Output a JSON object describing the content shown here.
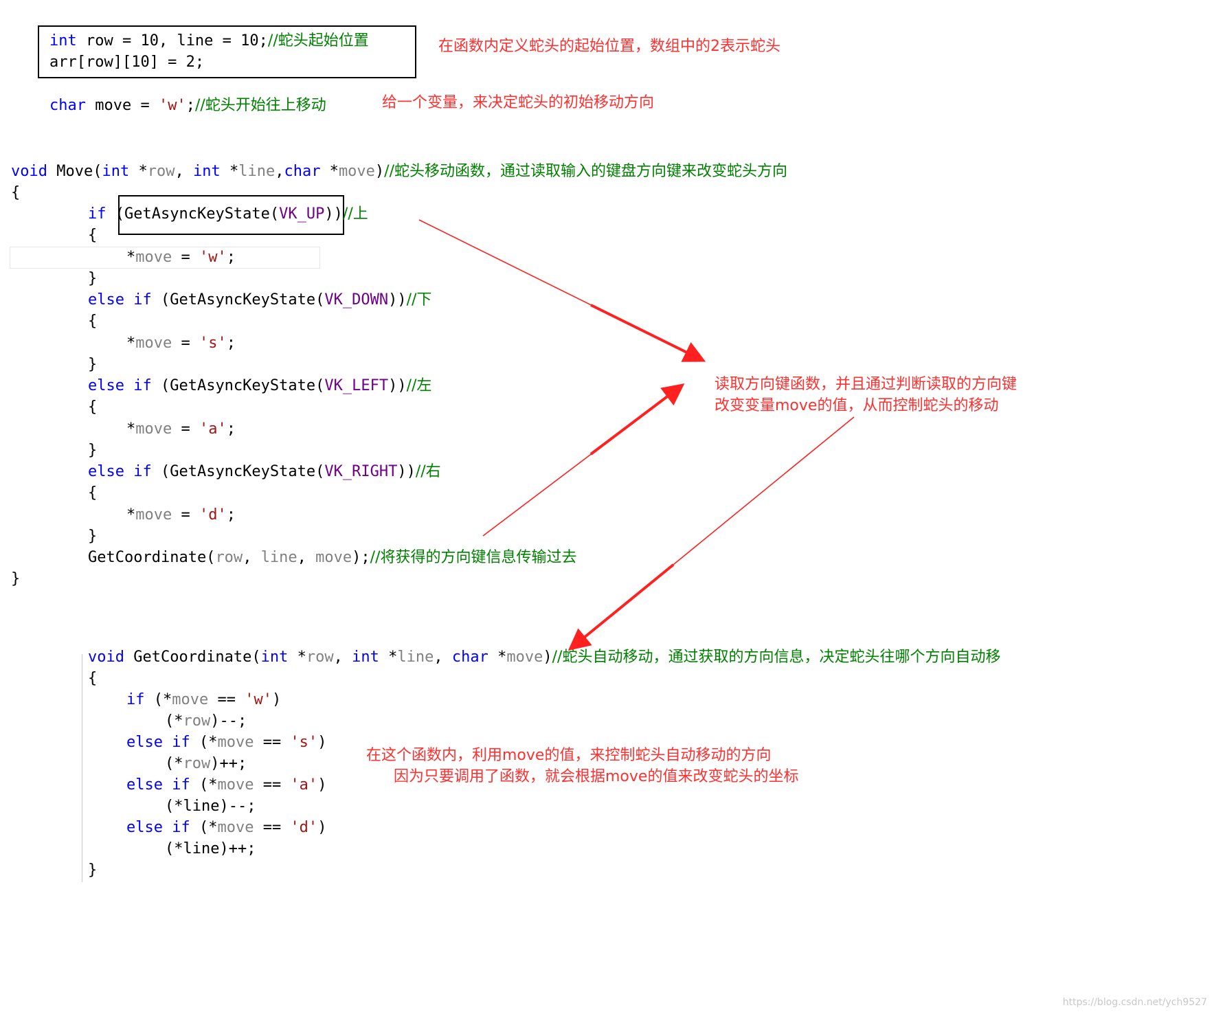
{
  "code_top": {
    "line1": {
      "kw": "int",
      "rest": " row = 10, line = 10;",
      "comment": "//蛇头起始位置"
    },
    "line2": {
      "rest": "arr[row][10] = 2;"
    },
    "line3": {
      "kw": "char",
      "rest1": " move = ",
      "str": "'w'",
      "rest2": ";",
      "comment": "//蛇头开始往上移动"
    }
  },
  "move_func": {
    "sig_void": "void",
    "sig_name": " Move(",
    "sig_int1": "int",
    "sig_p1": " *",
    "sig_row": "row",
    "sig_c1": ", ",
    "sig_int2": "int",
    "sig_p2": " *",
    "sig_line": "line",
    "sig_c2": ",",
    "sig_char": "char",
    "sig_p3": " *",
    "sig_move": "move",
    "sig_end": ")",
    "sig_comment": "//蛇头移动函数，通过读取输入的键盘方向键来改变蛇头方向",
    "open": "{",
    "close": "}",
    "if_kw": "if",
    "else_if_kw": "else if",
    "call_prefix": "(GetAsyncKeyState(",
    "call_suffix": "))",
    "vk_up": "VK_UP",
    "vk_down": "VK_DOWN",
    "vk_left": "VK_LEFT",
    "vk_right": "VK_RIGHT",
    "c_up": "//上",
    "c_down": "//下",
    "c_left": "//左",
    "c_right": "//右",
    "inner_open": "{",
    "inner_close": "}",
    "star": "*",
    "move_var": "move",
    "assign": " = ",
    "val_w": "'w'",
    "val_s": "'s'",
    "val_a": "'a'",
    "val_d": "'d'",
    "semi": ";",
    "getcoord_call": "GetCoordinate(",
    "arg_row": "row",
    "arg_line": "line",
    "arg_move": "move",
    "comma": ", ",
    "call_end": ");",
    "getcoord_comment": "//将获得的方向键信息传输过去"
  },
  "coord_func": {
    "sig_void": "void",
    "sig_name": " GetCoordinate(",
    "sig_int1": "int",
    "sig_p1": " *",
    "sig_row": "row",
    "sig_c1": ", ",
    "sig_int2": "int",
    "sig_p2": " *",
    "sig_line": "line",
    "sig_c2": ", ",
    "sig_char": "char",
    "sig_p3": " *",
    "sig_move": "move",
    "sig_end": ")",
    "sig_comment": "//蛇头自动移动，通过获取的方向信息，决定蛇头往哪个方向自动移",
    "open": "{",
    "close": "}",
    "if_kw": "if",
    "else_if_kw": "else if",
    "cond_open": " (*",
    "move_var": "move",
    "eq": " == ",
    "val_w": "'w'",
    "val_s": "'s'",
    "val_a": "'a'",
    "val_d": "'d'",
    "cond_close": ")",
    "stmt_open": "(*",
    "row": "row",
    "line": "line",
    "dec": ")--;",
    "inc": ")++;"
  },
  "notes": {
    "n1": "在函数内定义蛇头的起始位置，数组中的2表示蛇头",
    "n2": "给一个变量，来决定蛇头的初始移动方向",
    "n3a": "读取方向键函数，并且通过判断读取的方向键",
    "n3b": "改变变量move的值，从而控制蛇头的移动",
    "n4a": "在这个函数内，利用move的值，来控制蛇头自动移动的方向",
    "n4b": "因为只要调用了函数，就会根据move的值来改变蛇头的坐标"
  },
  "watermark": "https://blog.csdn.net/ych9527",
  "colors": {
    "keyword": "#0000ff",
    "param": "#808080",
    "string": "#a31515",
    "comment": "#008000",
    "macro": "#6f008a",
    "annotation": "#ff3030"
  }
}
